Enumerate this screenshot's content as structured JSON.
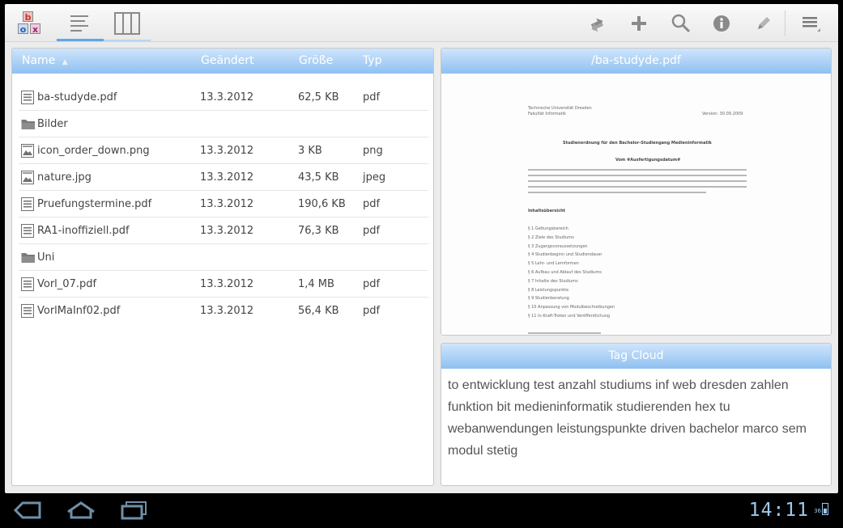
{
  "app": {
    "logo_letters": [
      "b",
      "o",
      "x"
    ]
  },
  "actionbar": {
    "tabs": [
      {
        "name": "list-view",
        "icon": "list-icon",
        "active": true
      },
      {
        "name": "column-view",
        "icon": "columns-icon",
        "active": false
      }
    ],
    "actions": [
      "sync-icon",
      "add-icon",
      "search-icon",
      "info-icon",
      "edit-icon",
      "menu-icon"
    ]
  },
  "files": {
    "columns": {
      "name": "Name",
      "changed": "Geändert",
      "size": "Größe",
      "type": "Typ"
    },
    "sort_indicator": "▲",
    "rows": [
      {
        "icon": "document-icon",
        "name": "ba-studyde.pdf",
        "changed": "13.3.2012",
        "size": "62,5 KB",
        "type": "pdf"
      },
      {
        "icon": "folder-icon",
        "name": "Bilder",
        "changed": "",
        "size": "",
        "type": ""
      },
      {
        "icon": "image-icon",
        "name": "icon_order_down.png",
        "changed": "13.3.2012",
        "size": "3 KB",
        "type": "png"
      },
      {
        "icon": "image-icon",
        "name": "nature.jpg",
        "changed": "13.3.2012",
        "size": "43,5 KB",
        "type": "jpeg"
      },
      {
        "icon": "document-icon",
        "name": "Pruefungstermine.pdf",
        "changed": "13.3.2012",
        "size": "190,6 KB",
        "type": "pdf"
      },
      {
        "icon": "document-icon",
        "name": "RA1-inoffiziell.pdf",
        "changed": "13.3.2012",
        "size": "76,3 KB",
        "type": "pdf"
      },
      {
        "icon": "folder-icon",
        "name": "Uni",
        "changed": "",
        "size": "",
        "type": ""
      },
      {
        "icon": "document-icon",
        "name": "Vorl_07.pdf",
        "changed": "13.3.2012",
        "size": "1,4 MB",
        "type": "pdf"
      },
      {
        "icon": "document-icon",
        "name": "VorlMaInf02.pdf",
        "changed": "13.3.2012",
        "size": "56,4 KB",
        "type": "pdf"
      }
    ]
  },
  "preview": {
    "title": "/ba-studyde.pdf",
    "doc": {
      "header_left": "Technische Universität Dresden",
      "header_left2": "Fakultät Informatik",
      "header_right": "Version: 30.09.2009",
      "title": "Studienordnung für den Bachelor-Studiengang Medieninformatik",
      "subtitle": "Vom #Ausfertigungsdatum#",
      "section": "Inhaltsübersicht",
      "toc": [
        "§ 1 Geltungsbereich",
        "§ 2 Ziele des Studiums",
        "§ 3 Zugangsvoraussetzungen",
        "§ 4 Studienbeginn und Studiendauer",
        "§ 5 Lehr- und Lernformen",
        "§ 6 Aufbau und Ablauf des Studiums",
        "§ 7 Inhalte des Studiums",
        "§ 8 Leistungspunkte",
        "§ 9 Studienberatung",
        "§ 10 Anpassung von Modulbeschreibungen",
        "§ 11 In-Kraft-Treten und Veröffentlichung"
      ]
    }
  },
  "tagcloud": {
    "title": "Tag Cloud",
    "text": "to entwicklung test anzahl studiums inf web dresden zahlen funktion bit medieninformatik studierenden hex tu webanwendungen leistungspunkte driven bachelor marco sem modul stetig"
  },
  "systembar": {
    "clock": "14:11",
    "battery": "36"
  },
  "colors": {
    "header_gradient_top": "#cfe5fb",
    "header_gradient_bottom": "#8ec0f1",
    "active_tab": "#5ea7e6",
    "system_accent": "#9ec8ee"
  }
}
